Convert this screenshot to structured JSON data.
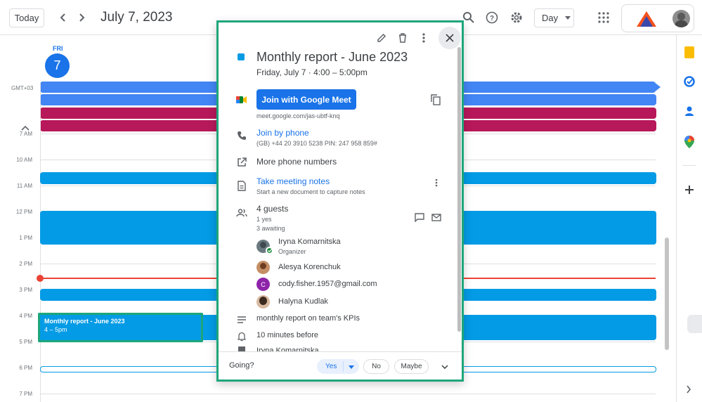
{
  "header": {
    "today_label": "Today",
    "date_title": "July 7, 2023",
    "view_label": "Day"
  },
  "day": {
    "weekday": "FRI",
    "number": "7",
    "timezone": "GMT+03"
  },
  "time_labels": [
    "7 AM",
    "10 AM",
    "11 AM",
    "12 PM",
    "1 PM",
    "2 PM",
    "3 PM",
    "4 PM",
    "5 PM",
    "6 PM",
    "7 PM"
  ],
  "selected_event": {
    "title": "Monthly report - June 2023",
    "time": "4 – 5pm"
  },
  "popup": {
    "title": "Monthly report - June 2023",
    "datetime": "Friday, July 7  ·  4:00 – 5:00pm",
    "meet_button": "Join with Google Meet",
    "meet_link": "meet.google.com/jas-ubtf-knq",
    "join_phone": "Join by phone",
    "phone_detail": "(GB) +44 20 3910 5238 PIN: 247 958 859#",
    "more_phones": "More phone numbers",
    "notes_title": "Take meeting notes",
    "notes_sub": "Start a new document to capture notes",
    "guests_title": "4 guests",
    "guests_yes": "1 yes",
    "guests_awaiting": "3 awaiting",
    "guests": [
      {
        "name": "Iryna Komarnitska",
        "role": "Organizer"
      },
      {
        "name": "Alesya Korenchuk",
        "role": ""
      },
      {
        "name": "cody.fisher.1957@gmail.com",
        "role": "",
        "initial": "C"
      },
      {
        "name": "Halyna Kudlak",
        "role": ""
      }
    ],
    "description": "monthly report on team's KPIs",
    "reminder": "10 minutes before",
    "organizer_cut": "Iryna Komarnitska",
    "going_label": "Going?",
    "rsvp_yes": "Yes",
    "rsvp_no": "No",
    "rsvp_maybe": "Maybe"
  },
  "colors": {
    "accent": "#1a73e8",
    "event_blue": "#039be5",
    "allday_blue": "#4285f4",
    "allday_magenta": "#b7185a",
    "now_red": "#ea4335",
    "highlight_green": "#1ea67a"
  }
}
